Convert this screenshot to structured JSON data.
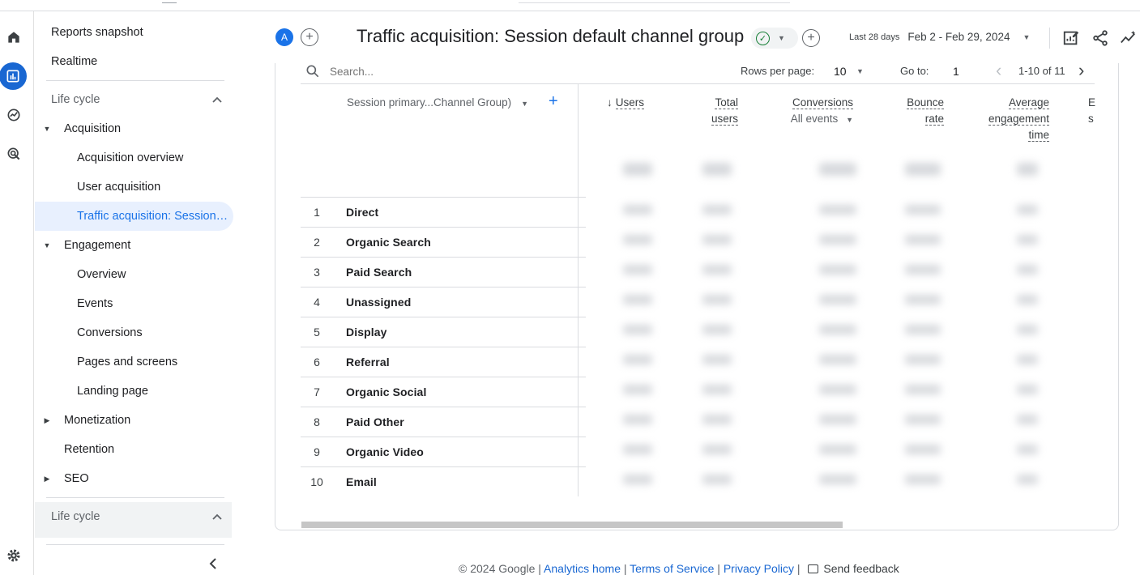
{
  "header": {
    "avatar_letter": "A",
    "title": "Traffic acquisition: Session default channel group",
    "date_label": "Last 28 days",
    "date_range": "Feb 2 - Feb 29, 2024"
  },
  "nav": {
    "reports_snapshot": "Reports snapshot",
    "realtime": "Realtime",
    "section1": "Life cycle",
    "acquisition": "Acquisition",
    "acquisition_overview": "Acquisition overview",
    "user_acquisition": "User acquisition",
    "traffic_acquisition": "Traffic acquisition: Session default channel group",
    "engagement": "Engagement",
    "overview": "Overview",
    "events": "Events",
    "conversions": "Conversions",
    "pages_and_screens": "Pages and screens",
    "landing_page": "Landing page",
    "monetization": "Monetization",
    "retention": "Retention",
    "seo": "SEO",
    "section2": "Life cycle"
  },
  "toolbar": {
    "search_placeholder": "Search...",
    "rows_per_page_label": "Rows per page:",
    "rows_per_page_value": "10",
    "goto_label": "Go to:",
    "goto_value": "1",
    "range_text": "1-10 of 11"
  },
  "table": {
    "dimension_header": "Session primary...Channel Group)",
    "metrics": {
      "users": "Users",
      "total_users_1": "Total",
      "total_users_2": "users",
      "conversions": "Conversions",
      "conversions_sub": "All events",
      "bounce_1": "Bounce",
      "bounce_2": "rate",
      "avg_1": "Average",
      "avg_2": "engagement",
      "avg_3": "time",
      "cut_1": "E",
      "cut_2": "s"
    },
    "rows": [
      {
        "n": "1",
        "name": "Direct"
      },
      {
        "n": "2",
        "name": "Organic Search"
      },
      {
        "n": "3",
        "name": "Paid Search"
      },
      {
        "n": "4",
        "name": "Unassigned"
      },
      {
        "n": "5",
        "name": "Display"
      },
      {
        "n": "6",
        "name": "Referral"
      },
      {
        "n": "7",
        "name": "Organic Social"
      },
      {
        "n": "8",
        "name": "Paid Other"
      },
      {
        "n": "9",
        "name": "Organic Video"
      },
      {
        "n": "10",
        "name": "Email"
      }
    ]
  },
  "footer": {
    "copyright": "© 2024 Google |",
    "analytics_home": "Analytics home",
    "sep1": "|",
    "terms": "Terms of Service",
    "sep2": "|",
    "privacy": "Privacy Policy",
    "sep3": "|",
    "feedback": "Send feedback"
  },
  "colors": {
    "accent": "#1a73e8",
    "selected_bg": "#e8f0fe",
    "success": "#188038"
  },
  "icons": [
    "home-icon",
    "reports-icon",
    "explore-icon",
    "advertising-icon",
    "settings-icon",
    "search-icon",
    "edit-report-icon",
    "share-icon",
    "insights-icon"
  ]
}
